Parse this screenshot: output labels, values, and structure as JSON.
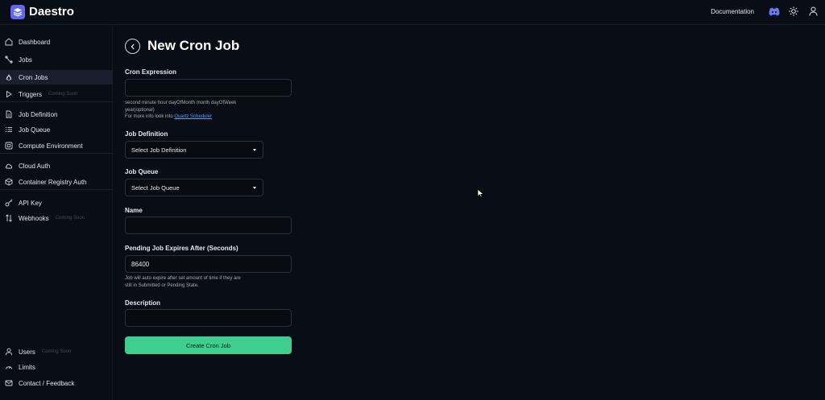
{
  "header": {
    "brand": "Daestro",
    "documentation_label": "Documentation",
    "icons": [
      "discord-icon",
      "theme-toggle-icon",
      "user-icon"
    ]
  },
  "sidebar": {
    "items": [
      {
        "label": "Dashboard",
        "icon": "home-icon"
      },
      {
        "label": "Jobs",
        "icon": "jobs-icon"
      },
      {
        "label": "Cron Jobs",
        "icon": "cron-icon",
        "active": true
      },
      {
        "label": "Triggers",
        "icon": "play-icon",
        "badge": "Coming Soon"
      },
      {
        "label": "Job Definition",
        "icon": "file-icon"
      },
      {
        "label": "Job Queue",
        "icon": "list-icon"
      },
      {
        "label": "Compute Environment",
        "icon": "server-icon"
      },
      {
        "label": "Cloud Auth",
        "icon": "cloud-icon"
      },
      {
        "label": "Container Registry Auth",
        "icon": "package-icon"
      },
      {
        "label": "API Key",
        "icon": "key-icon"
      },
      {
        "label": "Webhooks",
        "icon": "webhook-icon",
        "badge": "Coming Soon"
      }
    ],
    "bottom_items": [
      {
        "label": "Users",
        "icon": "users-icon",
        "badge": "Coming Soon"
      },
      {
        "label": "Limits",
        "icon": "gauge-icon"
      },
      {
        "label": "Contact / Feedback",
        "icon": "mail-icon"
      }
    ]
  },
  "form": {
    "title": "New Cron Job",
    "cron_label": "Cron Expression",
    "cron_value": "",
    "cron_help_line1": "second minute hour dayOfMonth month dayOfWeek",
    "cron_help_line2": "year(optional)",
    "cron_help_prefix": "For more info look into",
    "cron_help_link": "Quartz Scheduler",
    "job_definition_label": "Job Definition",
    "job_definition_value": "Select Job Definition",
    "job_queue_label": "Job Queue",
    "job_queue_value": "Select Job Queue",
    "name_label": "Name",
    "name_value": "",
    "expires_label": "Pending Job Expires After (Seconds)",
    "expires_value": "86400",
    "expires_help_line1": "Job will auto expire after set amount of time if they are",
    "expires_help_line2": "still in Submitted or Pending State.",
    "description_label": "Description",
    "description_value": "",
    "submit_label": "Create Cron Job"
  },
  "colors": {
    "background": "#090d16",
    "accent_button": "#3ecf8e",
    "brand": "#6366f1",
    "link": "#4ea3f5",
    "discord": "#5865f2"
  }
}
